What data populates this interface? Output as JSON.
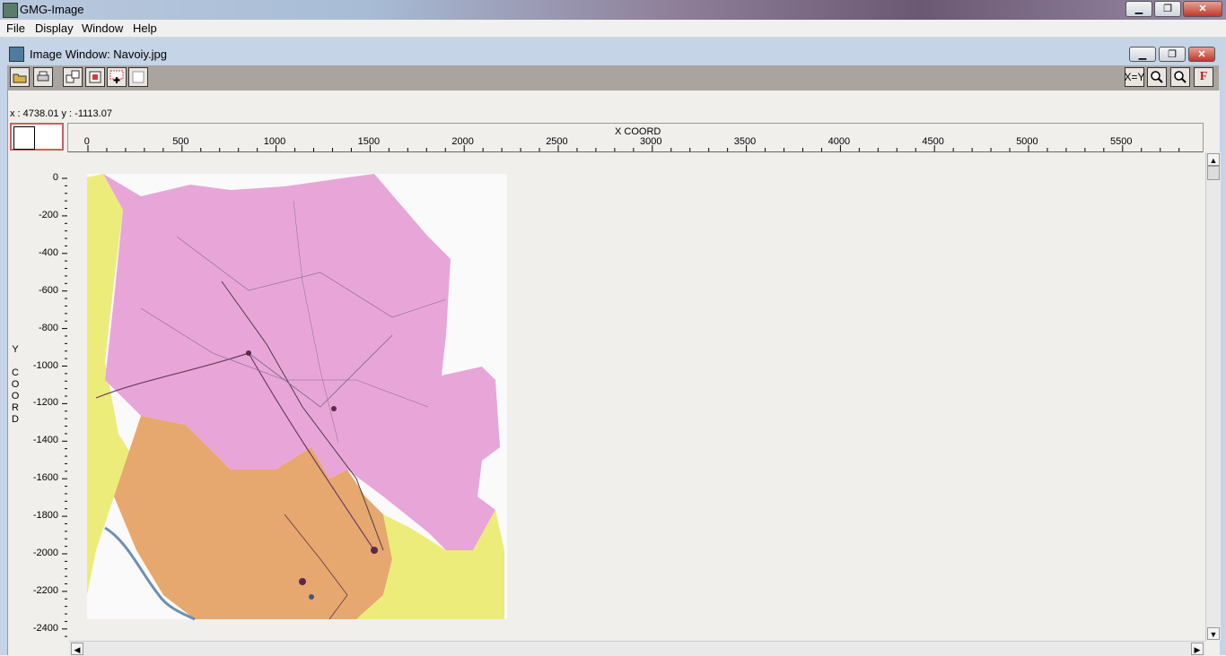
{
  "app": {
    "title": "GMG-Image"
  },
  "menu": {
    "items": [
      "File",
      "Display",
      "Window",
      "Help"
    ]
  },
  "window_buttons": {
    "minimize": "▁",
    "restore": "❐",
    "close": "✕"
  },
  "child": {
    "title": "Image Window: Navoiy.jpg"
  },
  "toolbar": {
    "left_icons": [
      "open-folder-icon",
      "print-icon",
      "move-window-icon",
      "stop-icon",
      "add-point-icon",
      "blank-icon"
    ],
    "right_buttons": {
      "xy": "X=Y",
      "zoom_in": "🔍",
      "zoom_out": "🔍",
      "flag": "F"
    }
  },
  "coords": {
    "readout": "x : 4738.01  y : -1113.07"
  },
  "x_axis": {
    "label": "X COORD",
    "ticks": [
      "0",
      "500",
      "1000",
      "1500",
      "2000",
      "2500",
      "3000",
      "3500",
      "4000",
      "4500",
      "5000",
      "5500"
    ]
  },
  "y_axis": {
    "label_letters": [
      "Y",
      "",
      "C",
      "O",
      "O",
      "R",
      "D"
    ],
    "ticks": [
      "0",
      "-200",
      "-400",
      "-600",
      "-800",
      "-1000",
      "-1200",
      "-1400",
      "-1600",
      "-1800",
      "-2000",
      "-2200",
      "-2400"
    ]
  },
  "map": {
    "colors": {
      "pink": "#e8a6d8",
      "yellow": "#ecec7a",
      "orange": "#e6a86f",
      "background": "#f0efec"
    }
  }
}
